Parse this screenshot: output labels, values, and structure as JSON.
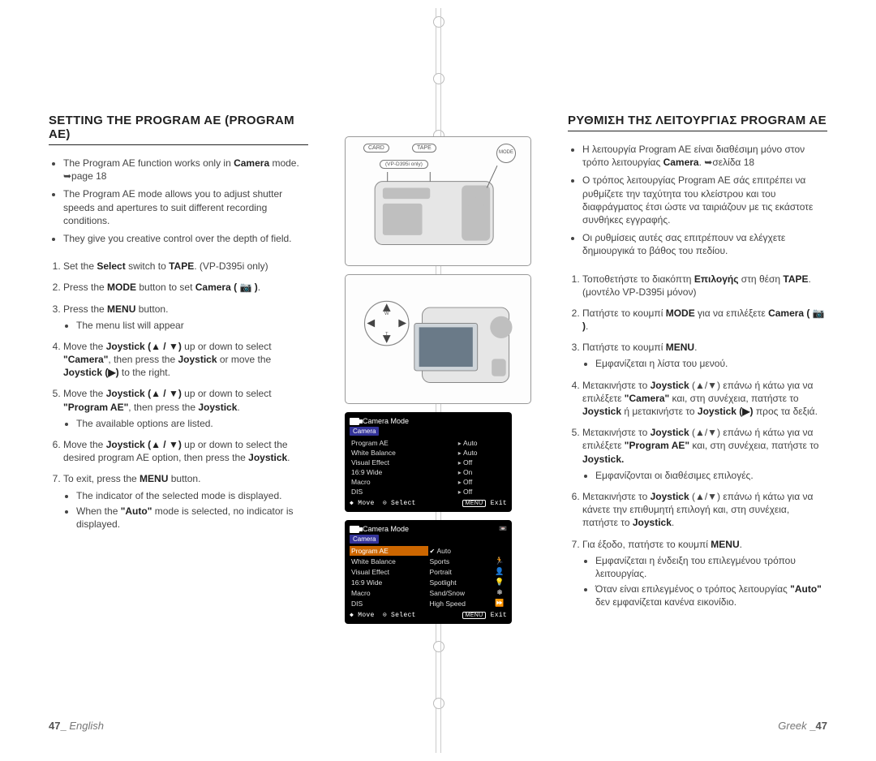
{
  "left": {
    "heading": "SETTING THE PROGRAM AE (PROGRAM AE)",
    "bullets": [
      "The Program AE function works only in <b>Camera</b> mode. ➥page 18",
      "The Program AE mode allows you to adjust shutter speeds and apertures to suit different recording conditions.",
      "They give you creative control over the depth of field."
    ],
    "steps": [
      {
        "html": "Set the <b>Select</b> switch to <b>TAPE</b>. (VP-D395i only)"
      },
      {
        "html": "Press the <b>MODE</b> button to set <b>Camera ( 📷 )</b>."
      },
      {
        "html": "Press the <b>MENU</b> button.",
        "sub": [
          "The menu list will appear"
        ]
      },
      {
        "html": "Move the <b>Joystick (▲ / ▼)</b> up or down to select <b>\"Camera\"</b>, then press the <b>Joystick</b> or move the <b>Joystick (▶)</b> to the right."
      },
      {
        "html": "Move the <b>Joystick (▲ / ▼)</b> up or down to select <b>\"Program AE\"</b>, then press the <b>Joystick</b>.",
        "sub": [
          "The available options are listed."
        ]
      },
      {
        "html": "Move the <b>Joystick (▲ / ▼)</b> up or down to select the desired program AE option, then press the <b>Joystick</b>."
      },
      {
        "html": "To exit, press the <b>MENU</b> button.",
        "sub": [
          "The indicator of the selected mode is displayed.",
          "When the <b>\"Auto\"</b> mode is selected, no indicator is displayed."
        ]
      }
    ],
    "footer_page": "47_",
    "footer_lang": "English"
  },
  "right": {
    "heading": "ΡΥΘΜΙΣΗ ΤΗΣ ΛΕΙΤΟΥΡΓΙΑΣ PROGRAM AE",
    "bullets": [
      "Η λειτουργία Program AE είναι διαθέσιμη μόνο στον τρόπο λειτουργίας <b>Camera</b>. ➥σελίδα 18",
      "Ο τρόπος λειτουργίας Program AE σάς επιτρέπει να ρυθμίζετε την ταχύτητα του κλείστρου και του διαφράγματος έτσι ώστε να ταιριάζουν με τις εκάστοτε συνθήκες εγγραφής.",
      "Οι ρυθμίσεις αυτές σας επιτρέπουν να ελέγχετε δημιουργικά το βάθος του πεδίου."
    ],
    "steps": [
      {
        "html": "Τοποθετήστε το διακόπτη <b>Επιλογής</b> στη θέση <b>TAPE</b>. (μοντέλο VP-D395i μόνον)"
      },
      {
        "html": "Πατήστε το κουμπί <b>MODE</b> για να επιλέξετε <b>Camera ( 📷 )</b>."
      },
      {
        "html": "Πατήστε το κουμπί <b>MENU</b>.",
        "sub": [
          "Εμφανίζεται η λίστα του μενού."
        ]
      },
      {
        "html": "Μετακινήστε το <b>Joystick</b> (▲/▼) επάνω ή κάτω για να επιλέξετε <b>\"Camera\"</b> και, στη συνέχεια, πατήστε το <b>Joystick</b> ή μετακινήστε το <b>Joystick (▶)</b> προς τα δεξιά."
      },
      {
        "html": "Μετακινήστε το <b>Joystick</b> (▲/▼) επάνω ή κάτω για να επιλέξετε <b>\"Program AE\"</b> και, στη συνέχεια, πατήστε το <b>Joystick.</b>",
        "sub": [
          "Εμφανίζονται οι διαθέσιμες επιλογές."
        ]
      },
      {
        "html": "Μετακινήστε το <b>Joystick</b> (▲/▼) επάνω ή κάτω για να κάνετε την επιθυμητή επιλογή και, στη συνέχεια, πατήστε το <b>Joystick</b>."
      },
      {
        "html": "Για έξοδο, πατήστε το κουμπί <b>MENU</b>.",
        "sub": [
          "Εμφανίζεται η ένδειξη του επιλεγμένου τρόπου λειτουργίας.",
          "Όταν είναι επιλεγμένος ο τρόπος λειτουργίας <b>\"Auto\"</b> δεν εμφανίζεται κανένα εικονίδιο."
        ]
      }
    ],
    "footer_lang": "Greek",
    "footer_page": "_47"
  },
  "figs": {
    "pill_card": "CARD",
    "pill_tape": "TAPE",
    "pill_mode": "MODE",
    "pill_vp": "(VP-D395i only)"
  },
  "lcd1": {
    "title": "Camera Mode",
    "crumb": "Camera",
    "rows": [
      {
        "k": "Program AE",
        "v": "Auto"
      },
      {
        "k": "White Balance",
        "v": "Auto"
      },
      {
        "k": "Visual Effect",
        "v": "Off"
      },
      {
        "k": "16:9 Wide",
        "v": "On"
      },
      {
        "k": "Macro",
        "v": "Off"
      },
      {
        "k": "DIS",
        "v": "Off"
      }
    ],
    "move": "Move",
    "select": "Select",
    "menu": "MENU",
    "exit": "Exit"
  },
  "lcd2": {
    "title": "Camera Mode",
    "crumb": "Camera",
    "rows": [
      {
        "k": "Program AE",
        "v": "Auto",
        "sel": true,
        "chk": true,
        "ic": ""
      },
      {
        "k": "White Balance",
        "v": "Sports",
        "ic": "🏃"
      },
      {
        "k": "Visual Effect",
        "v": "Portrait",
        "ic": "👤"
      },
      {
        "k": "16:9 Wide",
        "v": "Spotlight",
        "ic": "💡"
      },
      {
        "k": "Macro",
        "v": "Sand/Snow",
        "ic": "❄"
      },
      {
        "k": "DIS",
        "v": "High Speed",
        "ic": "⏩"
      }
    ],
    "move": "Move",
    "select": "Select",
    "menu": "MENU",
    "exit": "Exit"
  }
}
